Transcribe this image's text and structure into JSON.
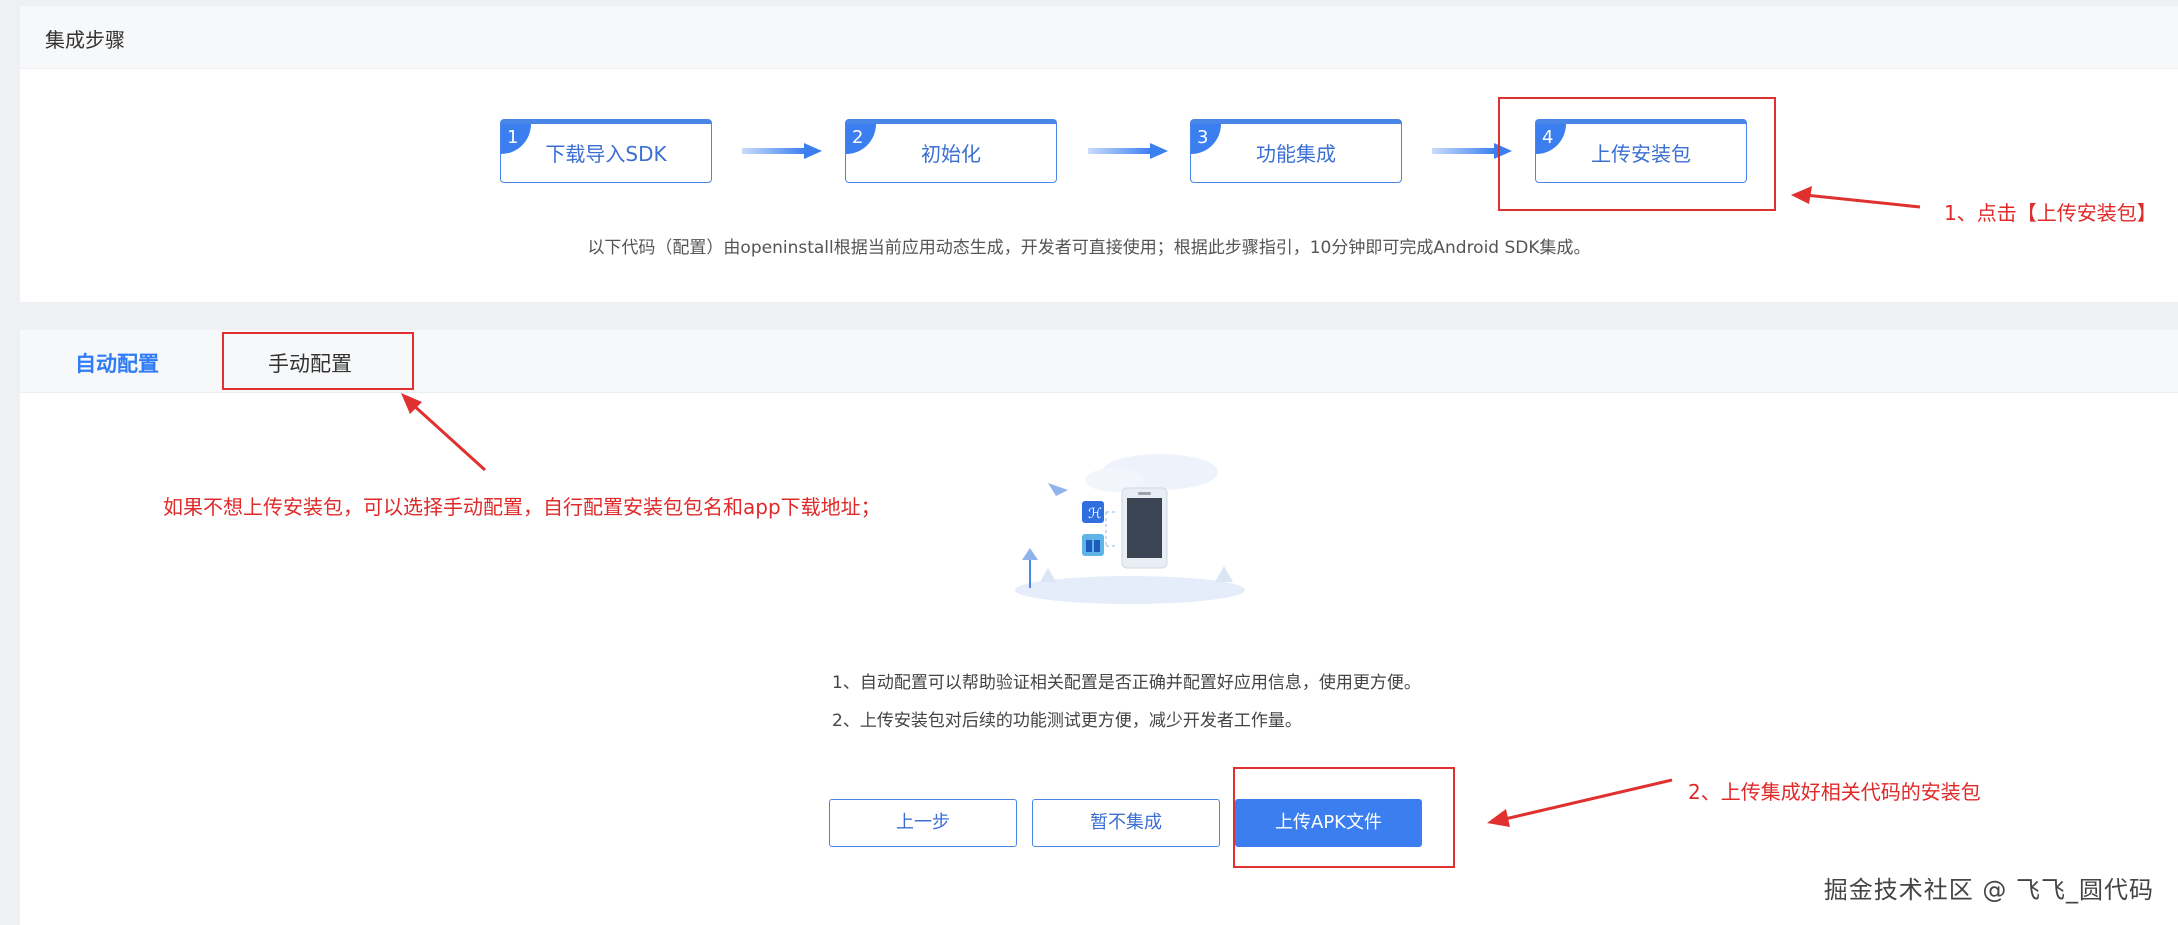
{
  "top_panel": {
    "title": "集成步骤",
    "steps": [
      {
        "num": "1",
        "label": "下载导入SDK"
      },
      {
        "num": "2",
        "label": "初始化"
      },
      {
        "num": "3",
        "label": "功能集成"
      },
      {
        "num": "4",
        "label": "上传安装包"
      }
    ],
    "intro": "以下代码（配置）由openinstall根据当前应用动态生成，开发者可直接使用；根据此步骤指引，10分钟即可完成Android SDK集成。"
  },
  "tabs": {
    "auto": "自动配置",
    "manual": "手动配置"
  },
  "info": {
    "line1": "1、自动配置可以帮助验证相关配置是否正确并配置好应用信息，使用更方便。",
    "line2": "2、上传安装包对后续的功能测试更方便，减少开发者工作量。"
  },
  "buttons": {
    "prev": "上一步",
    "skip": "暂不集成",
    "upload": "上传APK文件"
  },
  "annotations": {
    "a1": "1、点击【上传安装包】",
    "a2": "2、上传集成好相关代码的安装包",
    "a3": "如果不想上传安装包，可以选择手动配置，自行配置安装包包名和app下载地址；"
  },
  "watermark": "掘金技术社区 @ 飞飞_圆代码",
  "colors": {
    "accent": "#3b7ef0",
    "annotation_red": "#e03030"
  },
  "icons": [
    "step-arrow-icon",
    "upload-illustration",
    "paper-plane-icon",
    "phone-icon"
  ]
}
